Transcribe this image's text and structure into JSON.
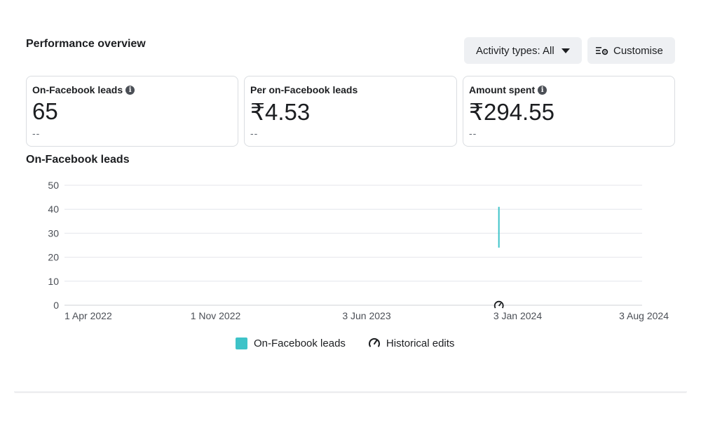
{
  "header": {
    "title": "Performance overview",
    "activity_button": "Activity types: All",
    "customise_button": "Customise"
  },
  "cards": [
    {
      "label": "On-Facebook leads",
      "value": "65",
      "delta": "--"
    },
    {
      "label": "Per on-Facebook leads",
      "value": "₹4.53",
      "delta": "--"
    },
    {
      "label": "Amount spent",
      "value": "₹294.55",
      "delta": "--"
    }
  ],
  "chart_data": {
    "type": "line",
    "title": "On-Facebook leads",
    "y_ticks": [
      0,
      10,
      20,
      30,
      40,
      50
    ],
    "ylim": [
      0,
      50
    ],
    "x_ticks": [
      "1 Apr 2022",
      "1 Nov 2022",
      "3 Jun 2023",
      "3 Jan 2024",
      "3 Aug 2024"
    ],
    "xlim": [
      "2022-04-01",
      "2024-08-03"
    ],
    "series": [
      {
        "name": "On-Facebook leads",
        "color": "#3ec3c8",
        "points": [
          {
            "x": "2024-01-04",
            "y": 24
          },
          {
            "x": "2024-01-04",
            "y": 41
          }
        ]
      }
    ],
    "historical_edits": [
      {
        "x": "2024-01-04"
      }
    ],
    "grid": true,
    "legend": [
      "On-Facebook leads",
      "Historical edits"
    ]
  },
  "colors": {
    "accent": "#3ec3c8",
    "button_bg": "#eef0f3",
    "grid": "#e4e6eb"
  }
}
